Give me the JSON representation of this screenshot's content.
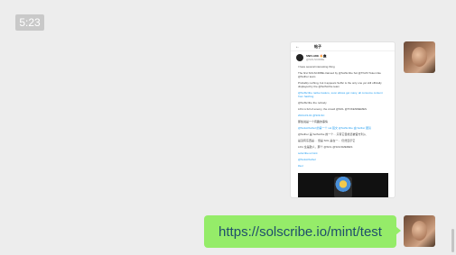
{
  "chat": {
    "timestamp": "5:23",
    "messages": [
      {
        "type": "image",
        "card": {
          "back_icon": "back-arrow-icon",
          "title": "帖子",
          "author_name": "SNFLAKE 🔥🏛",
          "author_handle": "@SOLSCRIBE",
          "paragraphs": [
            "I have several interesting thing",
            "The first SOLSCRIBE claimed by @SolScribe Sol @ThrZ3 Token like @SolFer team",
            "Probably nothing, but it appears SolSc is the only one yet still officially displayed by the @SolScribe team",
            "@SolScribe native feature, soon allows get many, all consume content from hashing",
            "@SolScribe the nobody",
            "LFG is full of enemy, the crowd @SOL @TOKENMEMES",
            "2024-03-01 @SOLSC",
            "那些说是一个有趣的事情",
            "@SolscribeSol 的第一个 sol 铭文 @SolScribe 由 SolFer 团队",
            "@SolFer 是 SolScribe 的一个... 只有它目前还被官方列入",
            "是没有东西是… 但是 SOL 是在一… 仍然显示它",
            "LFG 全是敌人，那个 @SOL @SOLSMEMES",
            "solscribe.io/mint",
            "@SolscribeSol",
            "#sol"
          ]
        }
      },
      {
        "type": "text",
        "text": "https://solscribe.io/mint/test"
      }
    ]
  },
  "colors": {
    "bubble": "#95ec69",
    "background": "#ededed",
    "link": "#1d9bf0"
  }
}
